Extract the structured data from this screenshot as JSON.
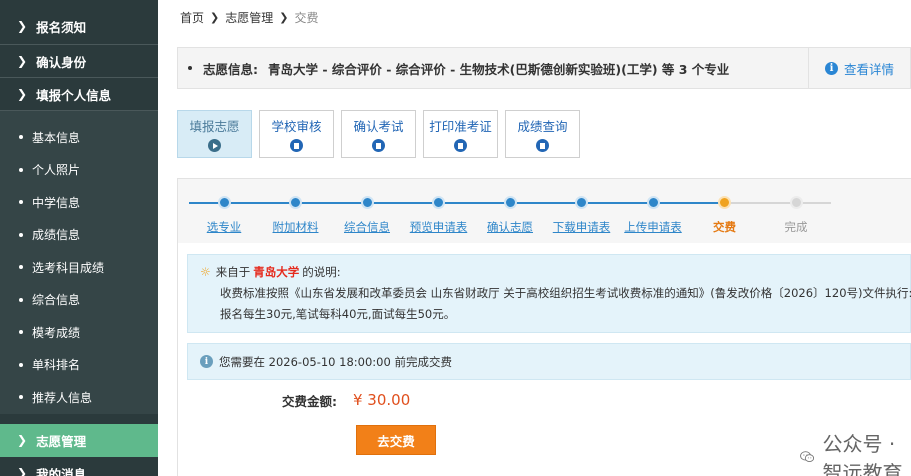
{
  "sidebar": {
    "top_items": [
      "报名须知",
      "确认身份",
      "填报个人信息"
    ],
    "sub_items": [
      "基本信息",
      "个人照片",
      "中学信息",
      "成绩信息",
      "选考科目成绩",
      "综合信息",
      "模考成绩",
      "单科排名",
      "推荐人信息"
    ],
    "active_item": "志愿管理",
    "bottom_item": "我的消息"
  },
  "breadcrumb": {
    "home": "首页",
    "section": "志愿管理",
    "current": "交费"
  },
  "info": {
    "label": "志愿信息:",
    "value": "青岛大学 - 综合评价 - 综合评价 - 生物技术(巴斯德创新实验班)(工学) 等 3 个专业",
    "detail_label": "查看详情"
  },
  "tabs": [
    {
      "label": "填报志愿",
      "icon": "play-icon"
    },
    {
      "label": "学校审核",
      "icon": "document-icon"
    },
    {
      "label": "确认考试",
      "icon": "document-icon"
    },
    {
      "label": "打印准考证",
      "icon": "document-icon"
    },
    {
      "label": "成绩查询",
      "icon": "document-icon"
    }
  ],
  "steps": [
    {
      "label": "选专业",
      "state": "done"
    },
    {
      "label": "附加材料",
      "state": "done"
    },
    {
      "label": "综合信息",
      "state": "done"
    },
    {
      "label": "预览申请表",
      "state": "done"
    },
    {
      "label": "确认志愿",
      "state": "done"
    },
    {
      "label": "下载申请表",
      "state": "done"
    },
    {
      "label": "上传申请表",
      "state": "done"
    },
    {
      "label": "交费",
      "state": "current"
    },
    {
      "label": "完成",
      "state": "pending"
    }
  ],
  "notice": {
    "prefix": "来自于",
    "school": "青岛大学",
    "suffix": "的说明:",
    "line2": "收费标准按照《山东省发展和改革委员会 山东省财政厅 关于高校组织招生考试收费标准的通知》(鲁发改价格〔2026〕120号)文件执行:",
    "line3": "报名每生30元,笔试每科40元,面试每生50元。"
  },
  "deadline": "您需要在 2026-05-10 18:00:00 前完成交费",
  "amount": {
    "label": "交费金额:",
    "value": "¥ 30.00"
  },
  "pay_button": "去交费",
  "watermark": "公众号 · 智远教育",
  "colors": {
    "sidebar_bg": "#2b3a3c",
    "sidebar_active": "#5fb98c",
    "link_blue": "#2e86c9",
    "current_orange": "#f0a21e",
    "pay_orange": "#f28018",
    "price_red": "#e0501e"
  }
}
